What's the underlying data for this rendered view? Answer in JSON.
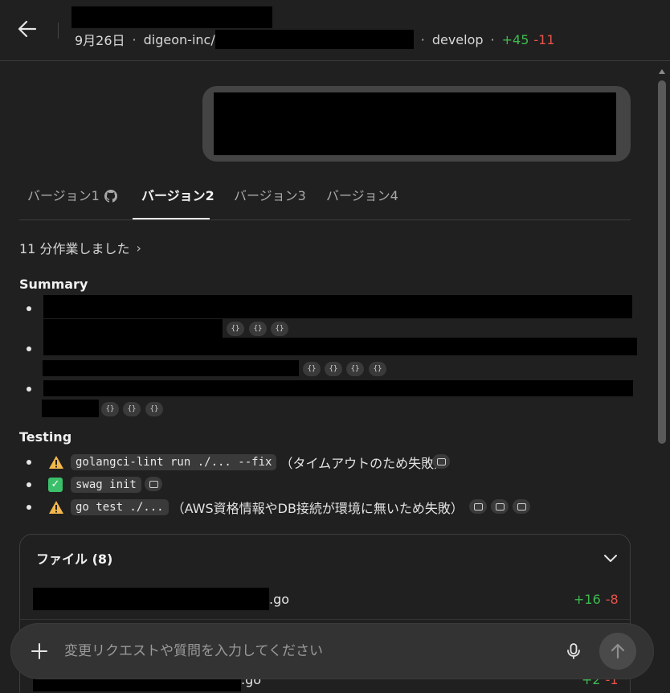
{
  "header": {
    "date": "9月26日",
    "repo_prefix": "digeon-inc/",
    "branch": "develop",
    "additions": "+45",
    "deletions": "-11"
  },
  "tabs": [
    {
      "label": "バージョン1",
      "icon": "github-icon"
    },
    {
      "label": "バージョン2",
      "active": true
    },
    {
      "label": "バージョン3"
    },
    {
      "label": "バージョン4"
    }
  ],
  "worked_label": "11 分作業しました",
  "summary": {
    "title": "Summary",
    "cite_label": "{}"
  },
  "testing": {
    "title": "Testing",
    "items": [
      {
        "status": "warning",
        "code": "golangci-lint run ./... --fix",
        "note": "（タイムアウトのため失敗）"
      },
      {
        "status": "success",
        "code": "swag init",
        "note": ""
      },
      {
        "status": "warning",
        "code": "go test ./...",
        "note": "（AWS資格情報やDB接続が環境に無いため失敗）"
      }
    ]
  },
  "files": {
    "title": "ファイル (8)",
    "rows": [
      {
        "ext": ".go",
        "additions": "+16",
        "deletions": "-8"
      },
      {
        "ext": ".go",
        "additions": "+2",
        "deletions": "-1"
      }
    ]
  },
  "composer": {
    "placeholder": "変更リクエストや質問を入力してください"
  },
  "colors": {
    "background": "#202020",
    "addition": "#3fb950",
    "deletion": "#e5534b",
    "warning": "#f2b84b",
    "success": "#3bbf6a"
  }
}
